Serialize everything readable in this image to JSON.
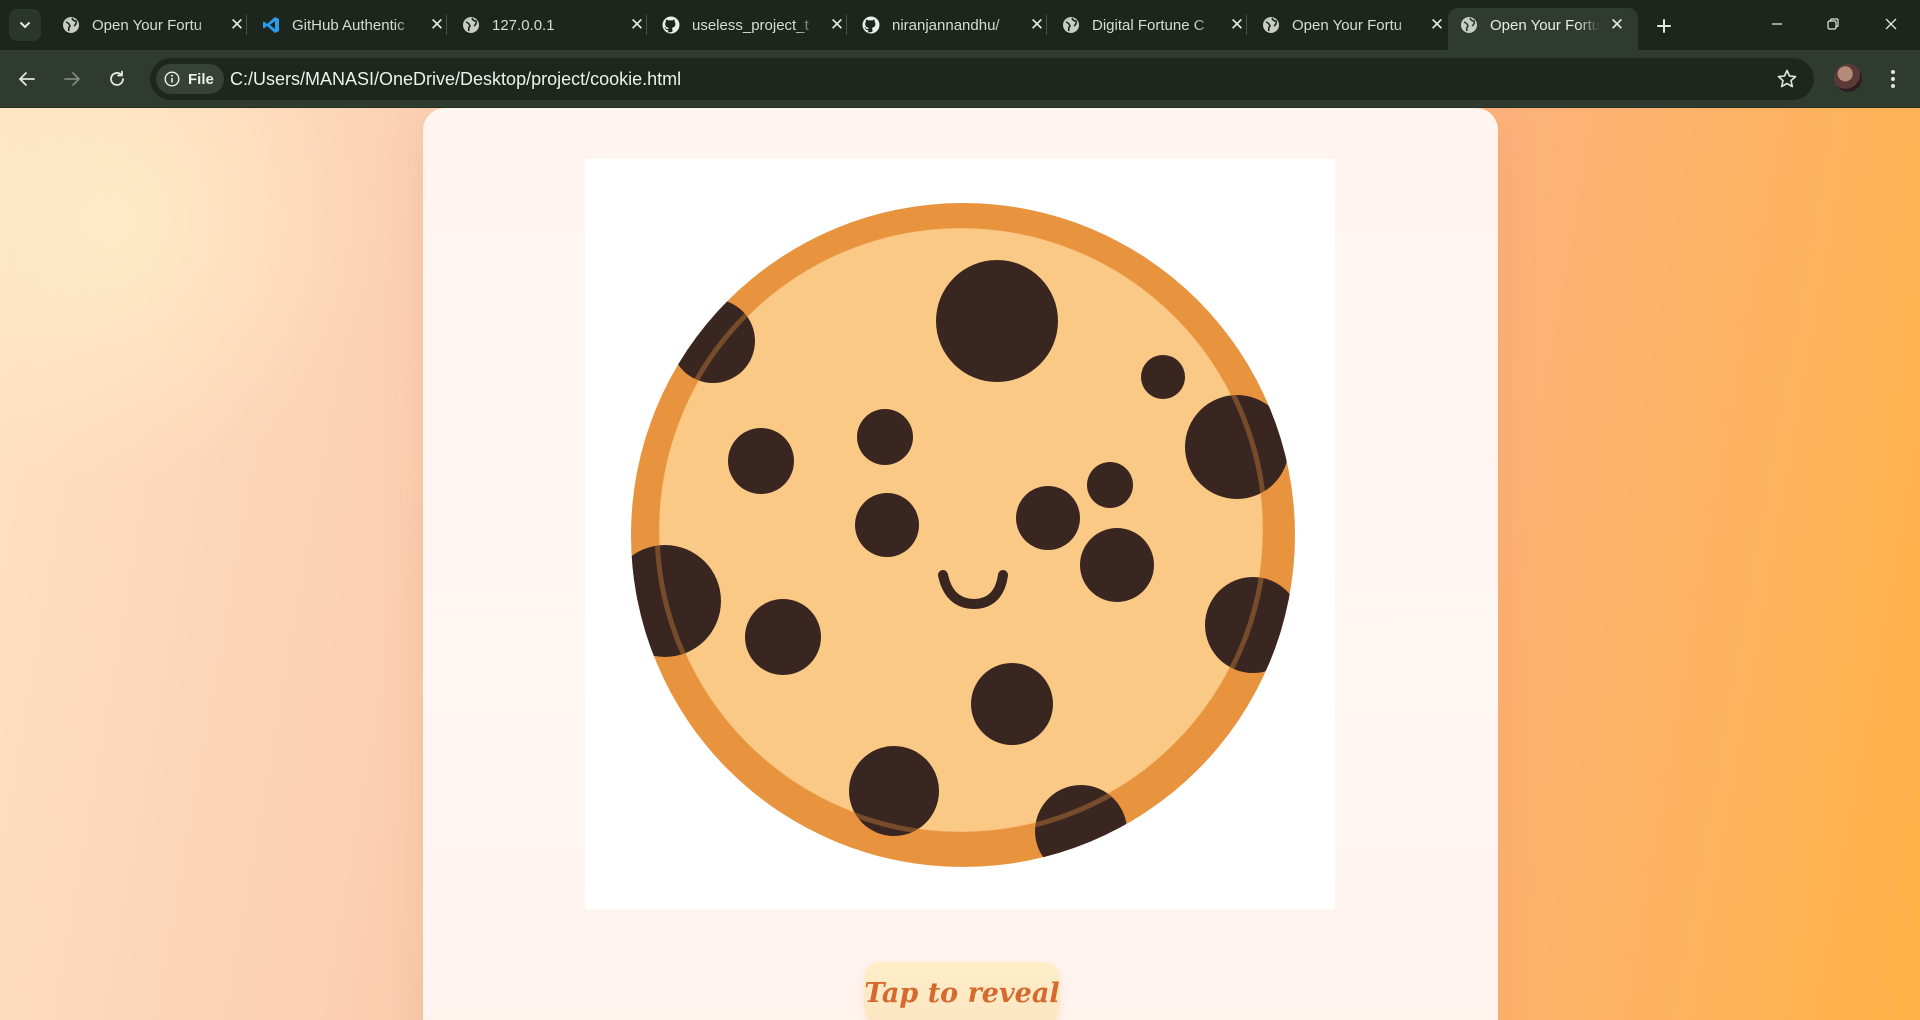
{
  "browser": {
    "tabs": [
      {
        "title": "Open Your Fortu",
        "icon": "globe-icon",
        "active": false
      },
      {
        "title": "GitHub Authentic",
        "icon": "vscode-icon",
        "active": false
      },
      {
        "title": "127.0.0.1",
        "icon": "globe-icon",
        "active": false
      },
      {
        "title": "useless_project_t",
        "icon": "github-icon",
        "active": false
      },
      {
        "title": "niranjannandhu/",
        "icon": "github-icon",
        "active": false
      },
      {
        "title": "Digital Fortune C",
        "icon": "globe-icon",
        "active": false
      },
      {
        "title": "Open Your Fortu",
        "icon": "globe-icon",
        "active": false
      },
      {
        "title": "Open Your Fortu",
        "icon": "globe-icon",
        "active": true
      }
    ],
    "address": {
      "chip_label": "File",
      "url": "C:/Users/MANASI/OneDrive/Desktop/project/cookie.html"
    }
  },
  "page": {
    "reveal_button_label": "Tap to reveal",
    "colors": {
      "cookie_dough": "#fbc986",
      "cookie_rim": "#e8943f",
      "chip": "#3a2620",
      "button_text": "#d5692e"
    }
  }
}
